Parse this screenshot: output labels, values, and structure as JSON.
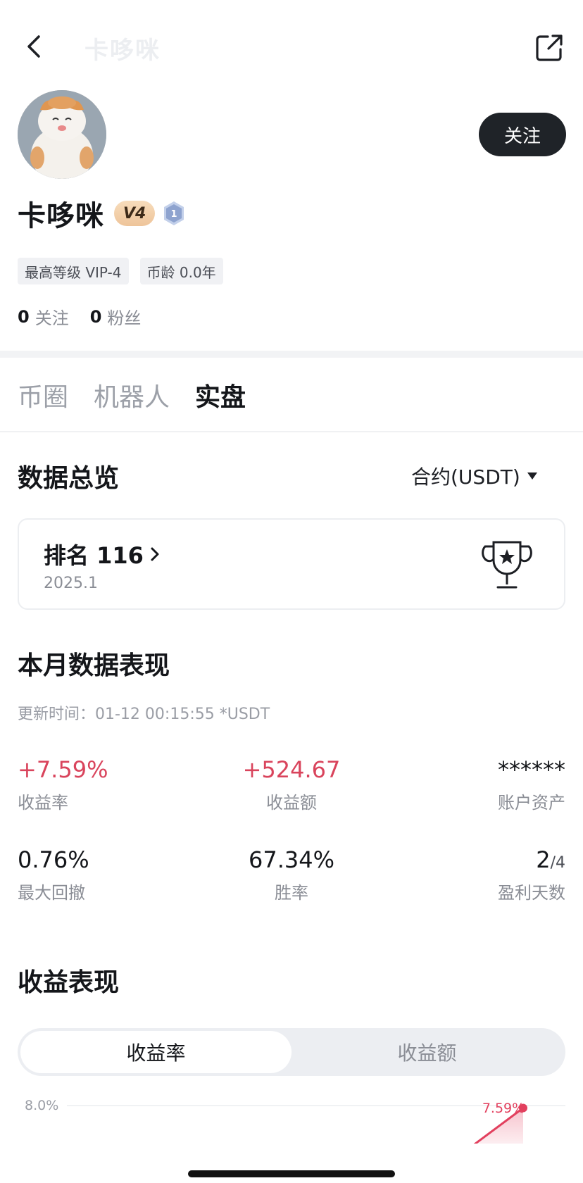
{
  "header": {
    "faded_title": "卡哆咪"
  },
  "profile": {
    "username": "卡哆咪",
    "vip_badge": "V4",
    "level_badge": "1",
    "follow_button": "关注",
    "tags": [
      "最高等级 VIP-4",
      "币龄 0.0年"
    ],
    "following_count": "0",
    "following_label": "关注",
    "followers_count": "0",
    "followers_label": "粉丝"
  },
  "tabs": [
    {
      "label": "币圈",
      "active": false
    },
    {
      "label": "机器人",
      "active": false
    },
    {
      "label": "实盘",
      "active": true
    }
  ],
  "overview": {
    "title": "数据总览",
    "contract_select": "合约(USDT)"
  },
  "rank": {
    "label": "排名 116",
    "date": "2025.1"
  },
  "monthly": {
    "title": "本月数据表现",
    "update_text": "更新时间：01-12 00:15:55 *USDT",
    "metrics": {
      "return_rate": {
        "value": "+7.59%",
        "label": "收益率"
      },
      "profit": {
        "value": "+524.67",
        "label": "收益额"
      },
      "assets": {
        "value": "******",
        "label": "账户资产"
      },
      "max_drawdown": {
        "value": "0.76%",
        "label": "最大回撤"
      },
      "win_rate": {
        "value": "67.34%",
        "label": "胜率"
      },
      "profit_days": {
        "value": "2",
        "total": "/4",
        "label": "盈利天数"
      }
    }
  },
  "performance": {
    "title": "收益表现",
    "toggle": {
      "active": "收益率",
      "inactive": "收益额"
    }
  },
  "chart_data": {
    "type": "area",
    "y_tick_labels": [
      "8.0%"
    ],
    "ylim": [
      0,
      8.0
    ],
    "end_label": "7.59%",
    "series": [
      {
        "values": [
          0.4,
          7.59
        ]
      }
    ],
    "grid": true
  },
  "colors": {
    "positive": "#d9445c",
    "follow_button_bg": "#1f2328",
    "badge_gold": "#eec49a"
  }
}
